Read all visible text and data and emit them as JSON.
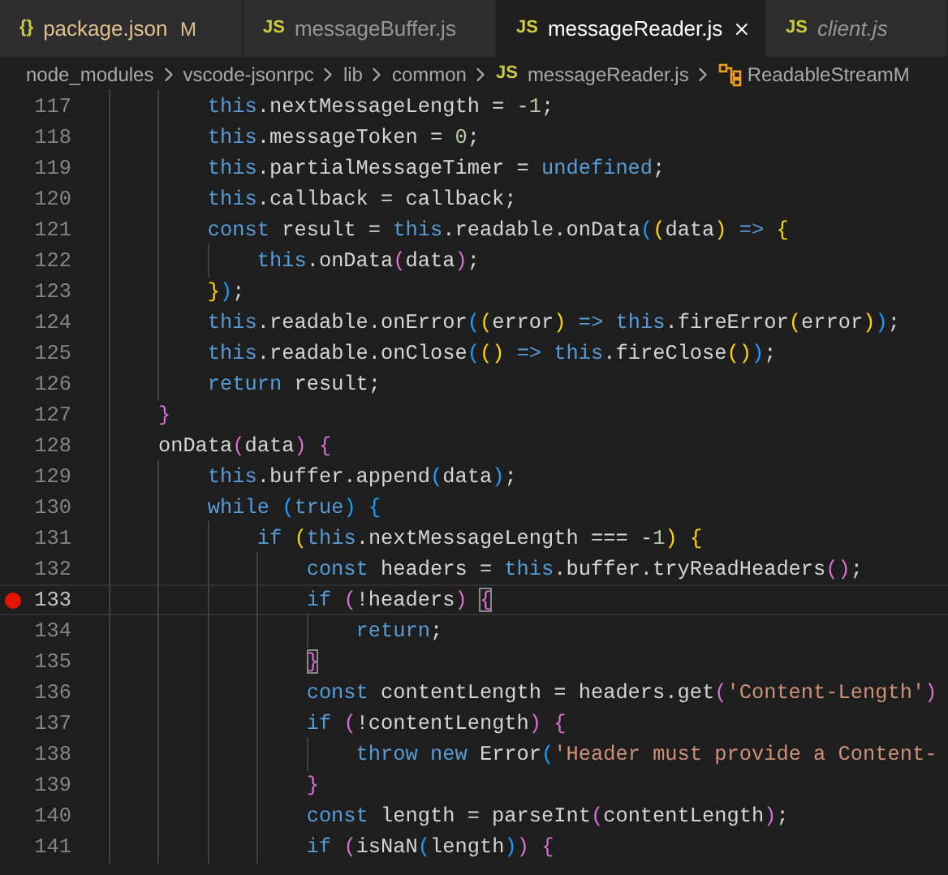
{
  "tabs": [
    {
      "icon": "{}",
      "label": "package.json",
      "badge": "M",
      "modified": true,
      "selected": false,
      "preview": false
    },
    {
      "icon": "JS",
      "label": "messageBuffer.js",
      "modified": false,
      "selected": false,
      "preview": false
    },
    {
      "icon": "JS",
      "label": "messageReader.js",
      "modified": false,
      "selected": true,
      "preview": false
    },
    {
      "icon": "JS",
      "label": "client.js",
      "modified": false,
      "selected": false,
      "preview": true
    }
  ],
  "breadcrumbs": [
    {
      "kind": "folder",
      "label": "node_modules"
    },
    {
      "kind": "folder",
      "label": "vscode-jsonrpc"
    },
    {
      "kind": "folder",
      "label": "lib"
    },
    {
      "kind": "folder",
      "label": "common"
    },
    {
      "kind": "file",
      "icon": "JS",
      "label": "messageReader.js"
    },
    {
      "kind": "class",
      "label": "ReadableStreamM"
    }
  ],
  "lines": [
    {
      "number": "117",
      "breakpoint": false,
      "current": false,
      "tokens": [
        {
          "kind": "kw",
          "text": "        this"
        },
        {
          "kind": "txt",
          "text": ".nextMessageLength = -"
        },
        {
          "kind": "num",
          "text": "1"
        },
        {
          "kind": "txt",
          "text": ";"
        }
      ]
    },
    {
      "number": "118",
      "breakpoint": false,
      "current": false,
      "tokens": [
        {
          "kind": "kw",
          "text": "        this"
        },
        {
          "kind": "txt",
          "text": ".messageToken = "
        },
        {
          "kind": "num",
          "text": "0"
        },
        {
          "kind": "txt",
          "text": ";"
        }
      ]
    },
    {
      "number": "119",
      "breakpoint": false,
      "current": false,
      "tokens": [
        {
          "kind": "kw",
          "text": "        this"
        },
        {
          "kind": "txt",
          "text": ".partialMessageTimer = "
        },
        {
          "kind": "kw",
          "text": "undefined"
        },
        {
          "kind": "txt",
          "text": ";"
        }
      ]
    },
    {
      "number": "120",
      "breakpoint": false,
      "current": false,
      "tokens": [
        {
          "kind": "kw",
          "text": "        this"
        },
        {
          "kind": "txt",
          "text": ".callback = callback;"
        }
      ]
    },
    {
      "number": "121",
      "breakpoint": false,
      "current": false,
      "tokens": [
        {
          "kind": "kw",
          "text": "        const"
        },
        {
          "kind": "txt",
          "text": " result = "
        },
        {
          "kind": "kw",
          "text": "this"
        },
        {
          "kind": "txt",
          "text": ".readable.onData"
        },
        {
          "kind": "b3",
          "text": "("
        },
        {
          "kind": "b1",
          "text": "("
        },
        {
          "kind": "txt",
          "text": "data"
        },
        {
          "kind": "b1",
          "text": ")"
        },
        {
          "kind": "kw",
          "text": " =>"
        },
        {
          "kind": "b1",
          "text": " {"
        }
      ]
    },
    {
      "number": "122",
      "breakpoint": false,
      "current": false,
      "tokens": [
        {
          "kind": "kw",
          "text": "            this"
        },
        {
          "kind": "txt",
          "text": ".onData"
        },
        {
          "kind": "b2",
          "text": "("
        },
        {
          "kind": "txt",
          "text": "data"
        },
        {
          "kind": "b2",
          "text": ")"
        },
        {
          "kind": "txt",
          "text": ";"
        }
      ]
    },
    {
      "number": "123",
      "breakpoint": false,
      "current": false,
      "tokens": [
        {
          "kind": "b1",
          "text": "        }"
        },
        {
          "kind": "b3",
          "text": ")"
        },
        {
          "kind": "txt",
          "text": ";"
        }
      ]
    },
    {
      "number": "124",
      "breakpoint": false,
      "current": false,
      "tokens": [
        {
          "kind": "kw",
          "text": "        this"
        },
        {
          "kind": "txt",
          "text": ".readable.onError"
        },
        {
          "kind": "b3",
          "text": "("
        },
        {
          "kind": "b1",
          "text": "("
        },
        {
          "kind": "txt",
          "text": "error"
        },
        {
          "kind": "b1",
          "text": ")"
        },
        {
          "kind": "kw",
          "text": " =>"
        },
        {
          "kind": "kw",
          "text": " this"
        },
        {
          "kind": "txt",
          "text": ".fireError"
        },
        {
          "kind": "b1",
          "text": "("
        },
        {
          "kind": "txt",
          "text": "error"
        },
        {
          "kind": "b1",
          "text": ")"
        },
        {
          "kind": "b3",
          "text": ")"
        },
        {
          "kind": "txt",
          "text": ";"
        }
      ]
    },
    {
      "number": "125",
      "breakpoint": false,
      "current": false,
      "tokens": [
        {
          "kind": "kw",
          "text": "        this"
        },
        {
          "kind": "txt",
          "text": ".readable.onClose"
        },
        {
          "kind": "b3",
          "text": "("
        },
        {
          "kind": "b1",
          "text": "()"
        },
        {
          "kind": "kw",
          "text": " =>"
        },
        {
          "kind": "kw",
          "text": " this"
        },
        {
          "kind": "txt",
          "text": ".fireClose"
        },
        {
          "kind": "b1",
          "text": "()"
        },
        {
          "kind": "b3",
          "text": ")"
        },
        {
          "kind": "txt",
          "text": ";"
        }
      ]
    },
    {
      "number": "126",
      "breakpoint": false,
      "current": false,
      "tokens": [
        {
          "kind": "kw",
          "text": "        return"
        },
        {
          "kind": "txt",
          "text": " result;"
        }
      ]
    },
    {
      "number": "127",
      "breakpoint": false,
      "current": false,
      "tokens": [
        {
          "kind": "b2",
          "text": "    }"
        }
      ]
    },
    {
      "number": "128",
      "breakpoint": false,
      "current": false,
      "tokens": [
        {
          "kind": "txt",
          "text": "    onData"
        },
        {
          "kind": "b2",
          "text": "("
        },
        {
          "kind": "txt",
          "text": "data"
        },
        {
          "kind": "b2",
          "text": ")"
        },
        {
          "kind": "b2",
          "text": " {"
        }
      ]
    },
    {
      "number": "129",
      "breakpoint": false,
      "current": false,
      "tokens": [
        {
          "kind": "kw",
          "text": "        this"
        },
        {
          "kind": "txt",
          "text": ".buffer.append"
        },
        {
          "kind": "b3",
          "text": "("
        },
        {
          "kind": "txt",
          "text": "data"
        },
        {
          "kind": "b3",
          "text": ")"
        },
        {
          "kind": "txt",
          "text": ";"
        }
      ]
    },
    {
      "number": "130",
      "breakpoint": false,
      "current": false,
      "tokens": [
        {
          "kind": "kw",
          "text": "        while"
        },
        {
          "kind": "b3",
          "text": " ("
        },
        {
          "kind": "kw",
          "text": "true"
        },
        {
          "kind": "b3",
          "text": ")"
        },
        {
          "kind": "b3",
          "text": " {"
        }
      ]
    },
    {
      "number": "131",
      "breakpoint": false,
      "current": false,
      "tokens": [
        {
          "kind": "kw",
          "text": "            if"
        },
        {
          "kind": "b1",
          "text": " ("
        },
        {
          "kind": "kw",
          "text": "this"
        },
        {
          "kind": "txt",
          "text": ".nextMessageLength === -"
        },
        {
          "kind": "num",
          "text": "1"
        },
        {
          "kind": "b1",
          "text": ")"
        },
        {
          "kind": "b1",
          "text": " {"
        }
      ]
    },
    {
      "number": "132",
      "breakpoint": false,
      "current": false,
      "tokens": [
        {
          "kind": "kw",
          "text": "                const"
        },
        {
          "kind": "txt",
          "text": " headers = "
        },
        {
          "kind": "kw",
          "text": "this"
        },
        {
          "kind": "txt",
          "text": ".buffer.tryReadHeaders"
        },
        {
          "kind": "b2",
          "text": "()"
        },
        {
          "kind": "txt",
          "text": ";"
        }
      ]
    },
    {
      "number": "133",
      "breakpoint": true,
      "current": true,
      "tokens": [
        {
          "kind": "kw",
          "text": "                if"
        },
        {
          "kind": "b2",
          "text": " ("
        },
        {
          "kind": "txt",
          "text": "!headers"
        },
        {
          "kind": "b2",
          "text": ") "
        },
        {
          "kind": "b2",
          "text": "{",
          "matched": true
        }
      ]
    },
    {
      "number": "134",
      "breakpoint": false,
      "current": false,
      "tokens": [
        {
          "kind": "kw",
          "text": "                    return"
        },
        {
          "kind": "txt",
          "text": ";"
        }
      ]
    },
    {
      "number": "135",
      "breakpoint": false,
      "current": false,
      "tokens": [
        {
          "kind": "b2",
          "text": "                }",
          "matched": true
        }
      ]
    },
    {
      "number": "136",
      "breakpoint": false,
      "current": false,
      "tokens": [
        {
          "kind": "kw",
          "text": "                const"
        },
        {
          "kind": "txt",
          "text": " contentLength = headers.get"
        },
        {
          "kind": "b2",
          "text": "("
        },
        {
          "kind": "str",
          "text": "'Content-Length'"
        },
        {
          "kind": "b2",
          "text": ")"
        }
      ]
    },
    {
      "number": "137",
      "breakpoint": false,
      "current": false,
      "tokens": [
        {
          "kind": "kw",
          "text": "                if"
        },
        {
          "kind": "b2",
          "text": " ("
        },
        {
          "kind": "txt",
          "text": "!contentLength"
        },
        {
          "kind": "b2",
          "text": ")"
        },
        {
          "kind": "b2",
          "text": " {"
        }
      ]
    },
    {
      "number": "138",
      "breakpoint": false,
      "current": false,
      "tokens": [
        {
          "kind": "kw",
          "text": "                    throw"
        },
        {
          "kind": "kw",
          "text": " new"
        },
        {
          "kind": "txt",
          "text": " Error"
        },
        {
          "kind": "b3",
          "text": "("
        },
        {
          "kind": "str",
          "text": "'Header must provide a Content-"
        }
      ]
    },
    {
      "number": "139",
      "breakpoint": false,
      "current": false,
      "tokens": [
        {
          "kind": "b2",
          "text": "                }"
        }
      ]
    },
    {
      "number": "140",
      "breakpoint": false,
      "current": false,
      "tokens": [
        {
          "kind": "kw",
          "text": "                const"
        },
        {
          "kind": "txt",
          "text": " length = parseInt"
        },
        {
          "kind": "b2",
          "text": "("
        },
        {
          "kind": "txt",
          "text": "contentLength"
        },
        {
          "kind": "b2",
          "text": ")"
        },
        {
          "kind": "txt",
          "text": ";"
        }
      ]
    },
    {
      "number": "141",
      "breakpoint": false,
      "current": false,
      "tokens": [
        {
          "kind": "kw",
          "text": "                if"
        },
        {
          "kind": "b2",
          "text": " ("
        },
        {
          "kind": "txt",
          "text": "isNaN"
        },
        {
          "kind": "b3",
          "text": "("
        },
        {
          "kind": "txt",
          "text": "length"
        },
        {
          "kind": "b3",
          "text": ")"
        },
        {
          "kind": "b2",
          "text": ")"
        },
        {
          "kind": "b2",
          "text": " {"
        }
      ]
    }
  ]
}
